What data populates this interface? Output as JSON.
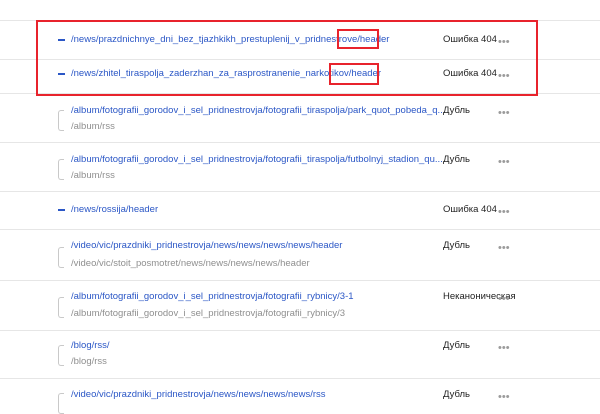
{
  "rows": [
    {
      "url": "/news/prazdnichnye_dni_bez_tjazhkikh_prestuplenij_v_pridnestrove/header",
      "sub": "",
      "status": "Ошибка 404",
      "marker": "dash"
    },
    {
      "url": "/news/zhitel_tiraspolja_zaderzhan_za_rasprostranenie_narkotikov/header",
      "sub": "",
      "status": "Ошибка 404",
      "marker": "dash"
    },
    {
      "url": "/album/fotografii_gorodov_i_sel_pridnestrovja/fotografii_tiraspolja/park_quot_pobeda_q...",
      "sub": "/album/rss",
      "status": "Дубль",
      "marker": "bracket"
    },
    {
      "url": "/album/fotografii_gorodov_i_sel_pridnestrovja/fotografii_tiraspolja/futbolnyj_stadion_qu...",
      "sub": "/album/rss",
      "status": "Дубль",
      "marker": "bracket"
    },
    {
      "url": "/news/rossija/header",
      "sub": "",
      "status": "Ошибка 404",
      "marker": "dash"
    },
    {
      "url": "/video/vic/prazdniki_pridnestrovja/news/news/news/news/header",
      "sub": "/video/vic/stoit_posmotret/news/news/news/news/header",
      "status": "Дубль",
      "marker": "bracket"
    },
    {
      "url": "/album/fotografii_gorodov_i_sel_pridnestrovja/fotografii_rybnicy/3-1",
      "sub": "/album/fotografii_gorodov_i_sel_pridnestrovja/fotografii_rybnicy/3",
      "status": "Неканоническая",
      "marker": "bracket"
    },
    {
      "url": "/blog/rss/",
      "sub": "/blog/rss",
      "status": "Дубль",
      "marker": "bracket"
    },
    {
      "url": "/video/vic/prazdniki_pridnestrovja/news/news/news/news/rss",
      "sub": "",
      "status": "Дубль",
      "marker": "bracket"
    }
  ],
  "more_label": "•••"
}
